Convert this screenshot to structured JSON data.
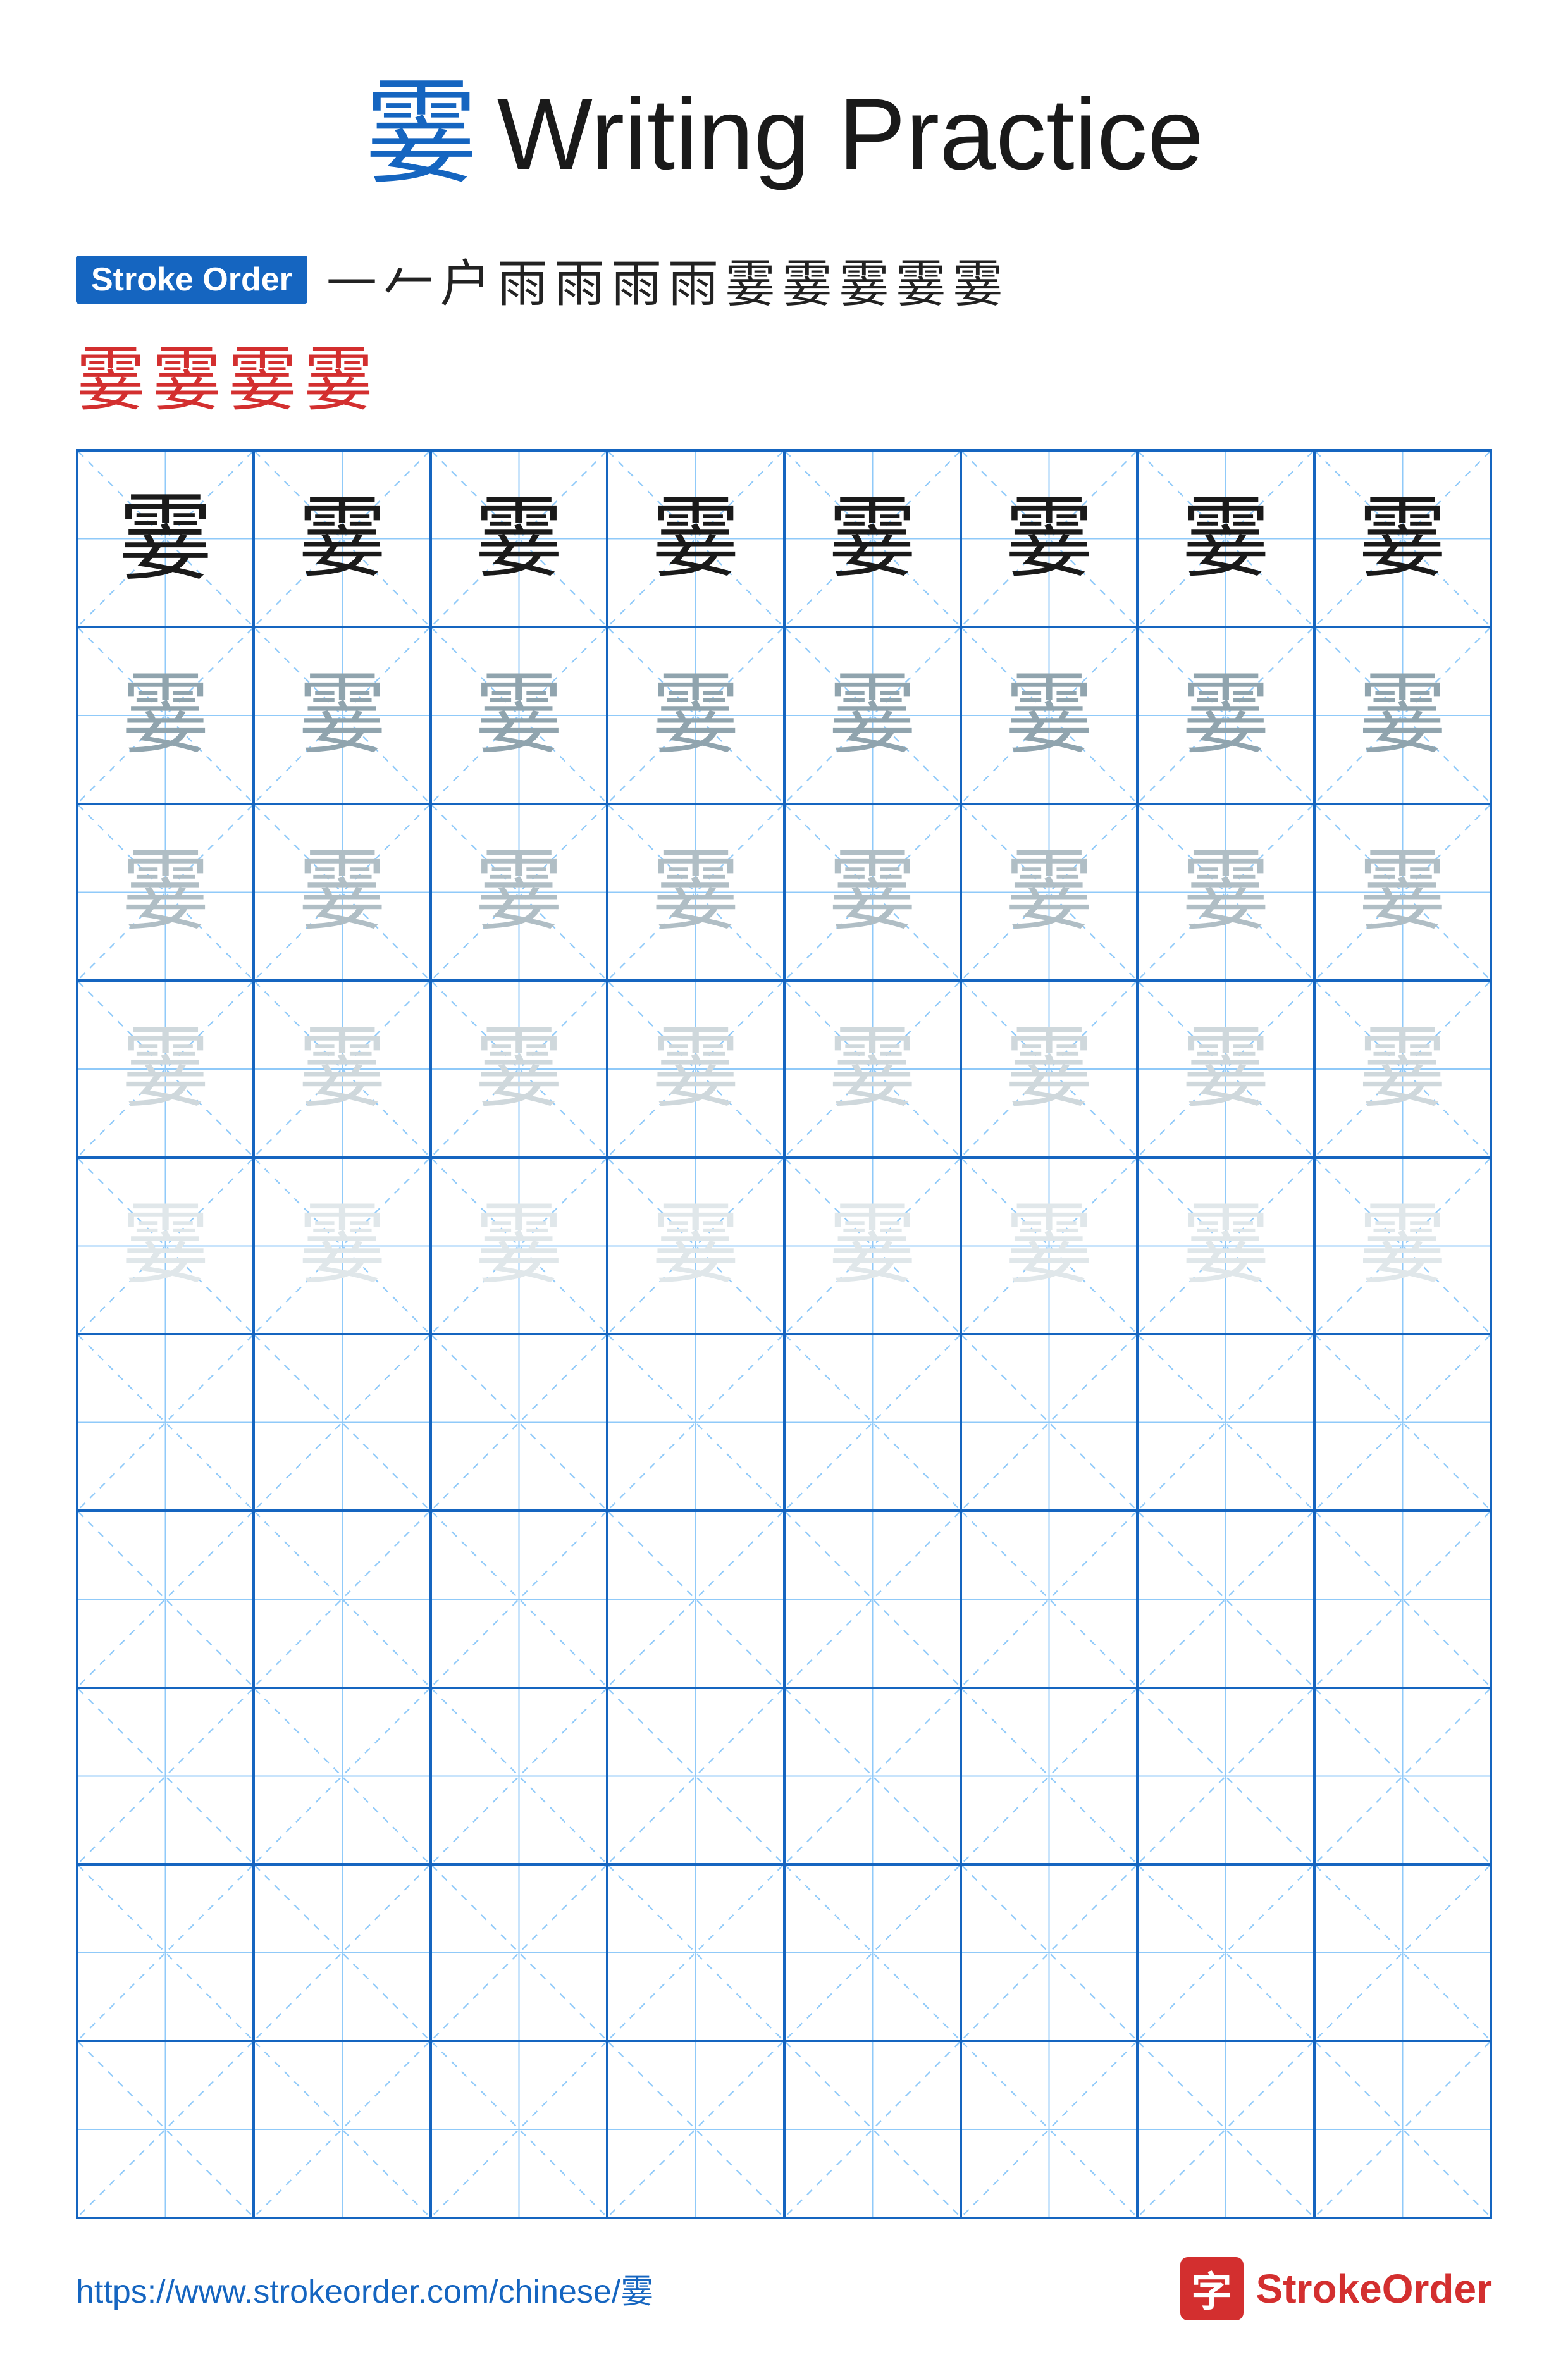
{
  "title": {
    "char": "霎",
    "text": "Writing Practice"
  },
  "stroke_order": {
    "badge_label": "Stroke Order",
    "sequence": [
      "一",
      "𠂉",
      "户",
      "雨",
      "雨",
      "雨",
      "雨",
      "霎",
      "霎",
      "霎",
      "霎",
      "霎"
    ],
    "row2": [
      "霎",
      "霎",
      "霎",
      "霎"
    ]
  },
  "grid": {
    "rows": 10,
    "cols": 8,
    "practice_char": "霎",
    "filled_rows": 5,
    "char_opacities": [
      "dark",
      "medium",
      "light",
      "very-light",
      "very-light"
    ]
  },
  "footer": {
    "url": "https://www.strokeorder.com/chinese/霎",
    "brand_icon": "字",
    "brand_name": "StrokeOrder"
  }
}
